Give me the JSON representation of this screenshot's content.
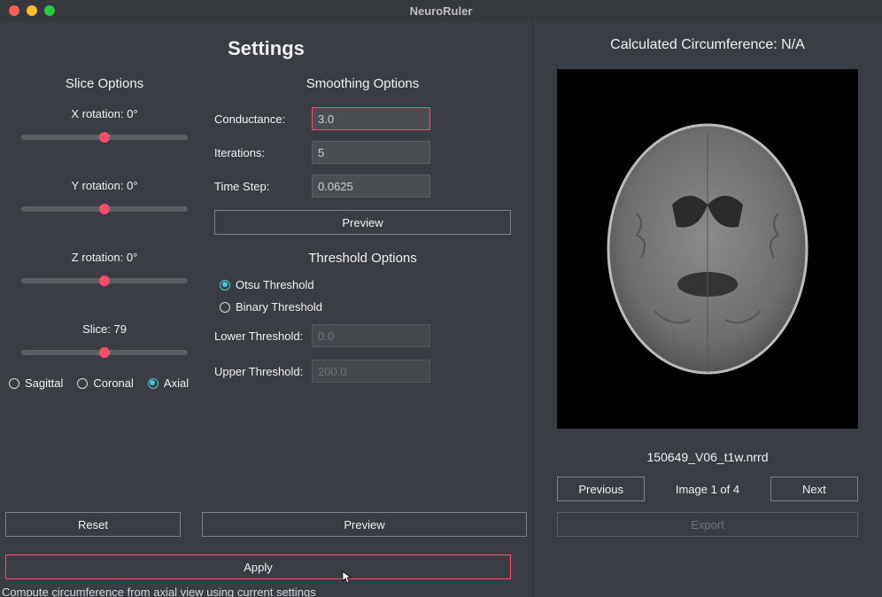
{
  "app": {
    "title": "NeuroRuler"
  },
  "settings": {
    "heading": "Settings",
    "slice_section": "Slice Options",
    "sliders": {
      "x_label": "X rotation: 0°",
      "y_label": "Y rotation: 0°",
      "z_label": "Z rotation: 0°",
      "slice_label": "Slice: 79"
    },
    "plane_radios": {
      "sagittal": "Sagittal",
      "coronal": "Coronal",
      "axial": "Axial"
    },
    "smoothing_section": "Smoothing Options",
    "smoothing": {
      "conductance_label": "Conductance:",
      "conductance_value": "3.0",
      "iterations_label": "Iterations:",
      "iterations_value": "5",
      "timestep_label": "Time Step:",
      "timestep_value": "0.0625",
      "preview": "Preview"
    },
    "threshold_section": "Threshold Options",
    "threshold": {
      "otsu": "Otsu Threshold",
      "binary": "Binary Threshold",
      "lower_label": "Lower Threshold:",
      "lower_value": "0.0",
      "upper_label": "Upper Threshold:",
      "upper_value": "200.0"
    },
    "reset": "Reset",
    "preview": "Preview",
    "apply": "Apply",
    "status": "Compute circumference from axial view using current settings"
  },
  "result": {
    "circumference": "Calculated Circumference: N/A",
    "filename": "150649_V06_t1w.nrrd",
    "prev": "Previous",
    "image_counter": "Image 1 of 4",
    "next": "Next",
    "export": "Export"
  }
}
